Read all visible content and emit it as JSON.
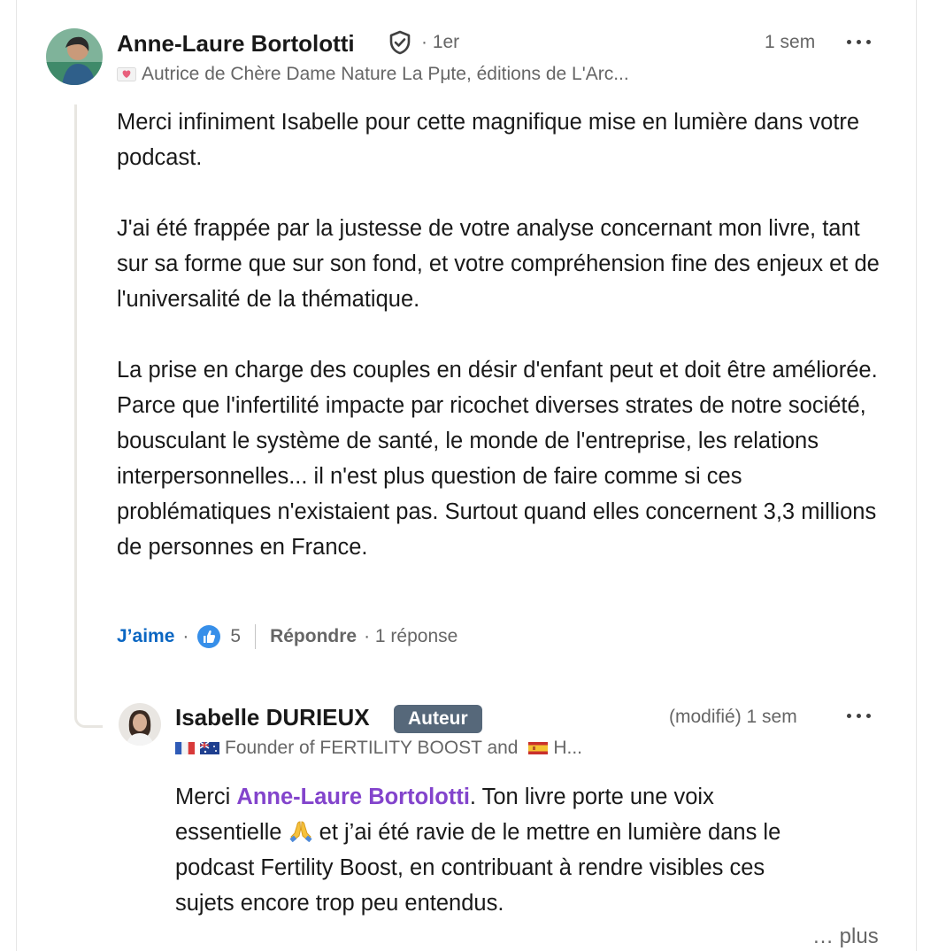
{
  "comment": {
    "author_name": "Anne-Laure Bortolotti",
    "degree": "· 1er",
    "time": "1 sem",
    "headline": "Autrice de Chère Dame Nature La Pμte, éditions de L'Arc...",
    "paragraphs": [
      "Merci infiniment Isabelle pour cette magnifique mise en lumière dans votre podcast.",
      "J'ai été frappée par la justesse de votre analyse concernant mon livre, tant sur sa forme que sur son fond, et votre compréhension fine des enjeux et de l'universalité de la thématique.",
      "La prise en charge des couples en désir d'enfant peut et doit être améliorée. Parce que l'infertilité impacte par ricochet diverses strates de notre société, bousculant le système de santé, le monde de l'entreprise, les relations interpersonnelles... il n'est plus question de faire comme si ces problématiques n'existaient pas. Surtout quand elles concernent 3,3 millions de personnes en France."
    ],
    "like_label": "J’aime",
    "dot": "·",
    "reaction_count": "5",
    "reply_label": "Répondre",
    "replies_count": "· 1 réponse",
    "icons": [
      "verified-shield-icon",
      "heart-emoji-icon",
      "like-reaction-icon",
      "more-options-icon"
    ]
  },
  "reply": {
    "author_name": "Isabelle DURIEUX",
    "badge": "Auteur",
    "time": "(modifié) 1 sem",
    "headline": "Founder of FERTILITY BOOST and",
    "headline_tail": "H...",
    "text_before_mention": "Merci ",
    "mention": "Anne-Laure Bortolotti",
    "text_line1_rest": ". Ton livre porte une voix",
    "text_line2_start": "essentielle ",
    "text_line2_rest": " et j’ai été ravie de le mettre en lumière dans le",
    "text_line3": "podcast Fertility Boost, en contribuant à rendre visibles ces",
    "text_line4": "sujets encore trop peu entendus.",
    "see_more": "… plus",
    "icons": [
      "france-flag-icon",
      "australia-flag-icon",
      "spain-flag-icon",
      "praying-hands-icon",
      "more-options-icon"
    ]
  }
}
